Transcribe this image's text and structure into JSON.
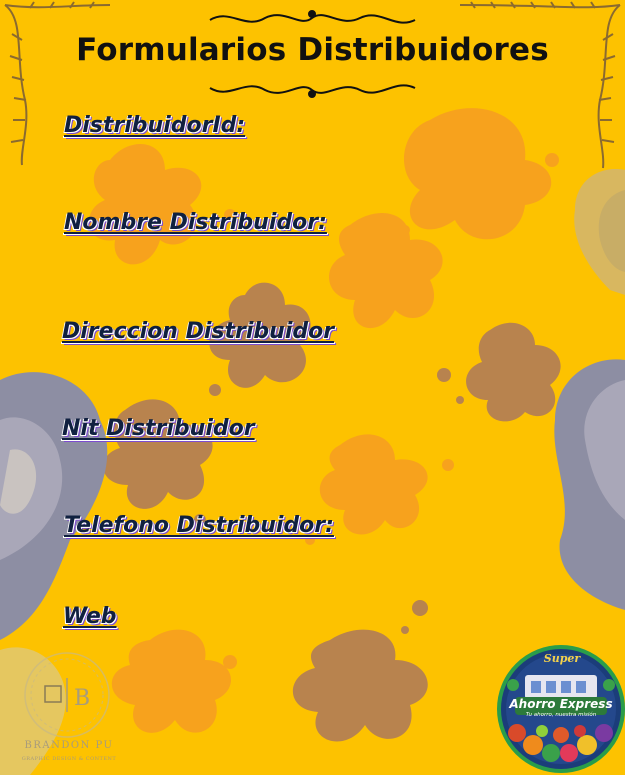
{
  "page": {
    "title": "Formularios Distribuidores",
    "background_color": "#fdc200"
  },
  "form": {
    "fields": [
      {
        "label": "DistribuidorId:"
      },
      {
        "label": "Nombre Distribuidor:"
      },
      {
        "label": "Direccion Distribuidor"
      },
      {
        "label": "Nit Distribuidor"
      },
      {
        "label": "Telefono Distribuidor:"
      },
      {
        "label": "Web"
      }
    ]
  },
  "brand_watermark": {
    "name": "BRANDON PU",
    "tagline": "GRAPHIC DESIGN & CONTENT",
    "monogram": "B"
  },
  "store_logo": {
    "prefix": "Super",
    "name": "Ahorro Express",
    "tagline": "Tu ahorro, nuestra misión"
  },
  "colors": {
    "accent_shadow": "#7c4ccf",
    "label_text": "#102040",
    "splash_orange": "#f7a21d",
    "splash_brown": "#b8834e",
    "smoke_grey": "#8d8ea3"
  }
}
